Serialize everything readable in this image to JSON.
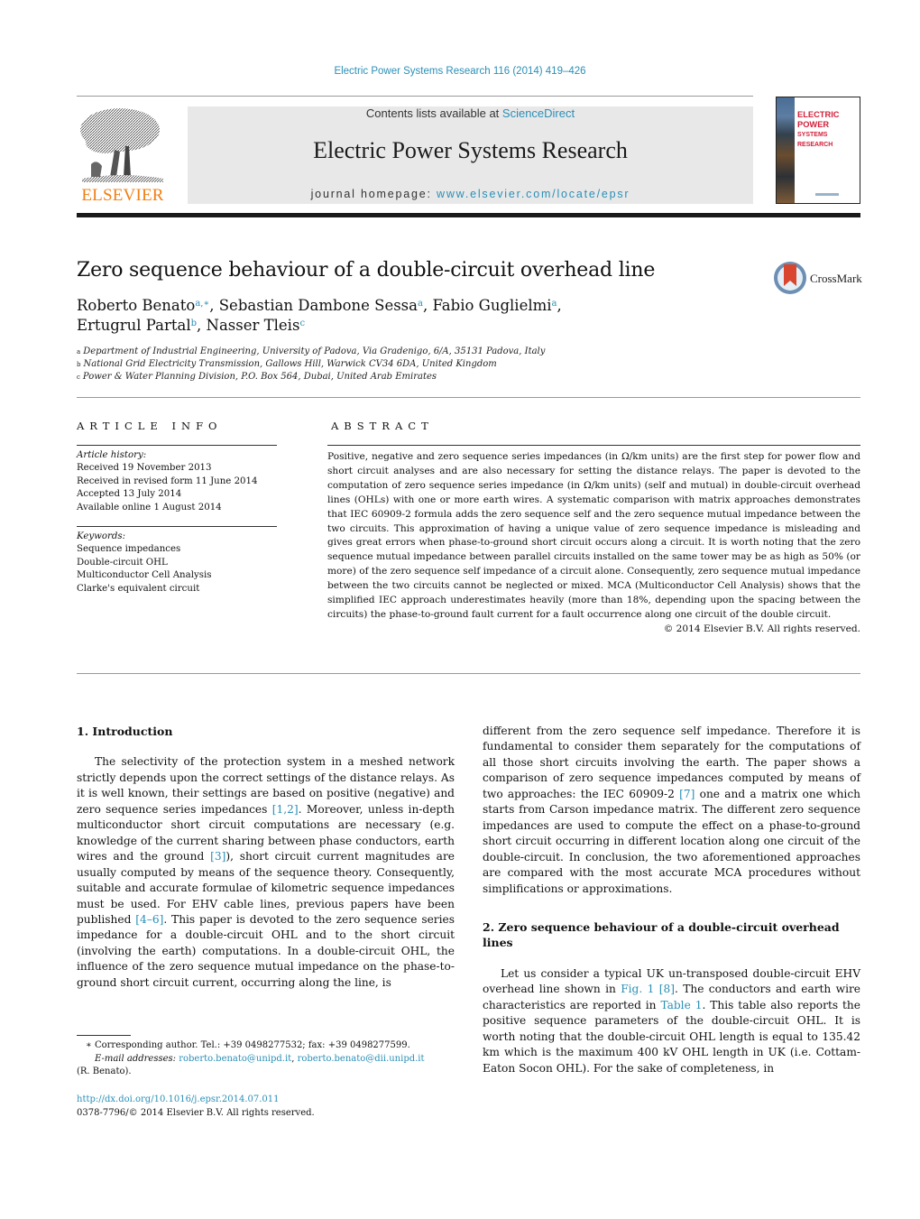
{
  "header": {
    "citation": "Electric Power Systems Research 116 (2014) 419–426",
    "publisher_logo_text": "ELSEVIER",
    "contents_prefix": "Contents lists available at ",
    "contents_link": "ScienceDirect",
    "journal_name": "Electric Power Systems Research",
    "homepage_prefix": "journal homepage: ",
    "homepage_link": "www.elsevier.com/locate/epsr",
    "cover_title_line1": "ELECTRIC POWER",
    "cover_title_line2": "SYSTEMS RESEARCH",
    "crossmark_label": "CrossMark",
    "colors": {
      "link": "#2a8fb7",
      "elsevier_orange": "#f07f13",
      "cover_red": "#d3203a",
      "banner_bg": "#e8e8e8"
    }
  },
  "article": {
    "title": "Zero sequence behaviour of a double-circuit overhead line",
    "authors": [
      {
        "name": "Roberto Benato",
        "sup": "a,∗",
        "sep": ", "
      },
      {
        "name": "Sebastian Dambone Sessa",
        "sup": "a",
        "sep": ", "
      },
      {
        "name": "Fabio Guglielmi",
        "sup": "a",
        "sep": ","
      },
      {
        "name": "Ertugrul Partal",
        "sup": "b",
        "sep": ", "
      },
      {
        "name": "Nasser Tleis",
        "sup": "c",
        "sep": ""
      }
    ],
    "affiliations": [
      {
        "key": "a",
        "text": "Department of Industrial Engineering, University of Padova, Via Gradenigo, 6/A, 35131 Padova, Italy"
      },
      {
        "key": "b",
        "text": "National Grid Electricity Transmission, Gallows Hill, Warwick CV34 6DA, United Kingdom"
      },
      {
        "key": "c",
        "text": "Power & Water Planning Division, P.O. Box 564, Dubai, United Arab Emirates"
      }
    ]
  },
  "article_info": {
    "heading": "ARTICLE INFO",
    "history_label": "Article history:",
    "history": [
      "Received 19 November 2013",
      "Received in revised form 11 June 2014",
      "Accepted 13 July 2014",
      "Available online 1 August 2014"
    ],
    "keywords_label": "Keywords:",
    "keywords": [
      "Sequence impedances",
      "Double-circuit OHL",
      "Multiconductor Cell Analysis",
      "Clarke's equivalent circuit"
    ]
  },
  "abstract": {
    "heading": "ABSTRACT",
    "text": "Positive, negative and zero sequence series impedances (in Ω/km units) are the first step for power flow and short circuit analyses and are also necessary for setting the distance relays. The paper is devoted to the computation of zero sequence series impedance (in Ω/km units) (self and mutual) in double-circuit overhead lines (OHLs) with one or more earth wires. A systematic comparison with matrix approaches demonstrates that IEC 60909-2 formula adds the zero sequence self and the zero sequence mutual impedance between the two circuits. This approximation of having a unique value of zero sequence impedance is misleading and gives great errors when phase-to-ground short circuit occurs along a circuit. It is worth noting that the zero sequence mutual impedance between parallel circuits installed on the same tower may be as high as 50% (or more) of the zero sequence self impedance of a circuit alone. Consequently, zero sequence mutual impedance between the two circuits cannot be neglected or mixed. MCA (Multiconductor Cell Analysis) shows that the simplified IEC approach underestimates heavily (more than 18%, depending upon the spacing between the circuits) the phase-to-ground fault current for a fault occurrence along one circuit of the double circuit.",
    "copyright": "© 2014 Elsevier B.V. All rights reserved."
  },
  "body": {
    "section1_heading": "1.  Introduction",
    "s1_p1_a": "The selectivity of the protection system in a meshed network strictly depends upon the correct settings of the distance relays. As it is well known, their settings are based on positive (negative) and zero sequence series impedances ",
    "s1_ref1": "[1,2]",
    "s1_p1_b": ". Moreover, unless in-depth multiconductor short circuit computations are necessary (e.g. knowledge of the current sharing between phase conductors, earth wires and the ground ",
    "s1_ref2": "[3]",
    "s1_p1_c": "), short circuit current magnitudes are usually computed by means of the sequence theory. Consequently, suitable and accurate formulae of kilometric sequence impedances must be used. For EHV cable lines, previous papers have been published ",
    "s1_ref3": "[4–6]",
    "s1_p1_d": ". This paper is devoted to the zero sequence series impedance for a double-circuit OHL and to the short circuit (involving the earth) computations. In a double-circuit OHL, the influence of the zero sequence mutual impedance on the phase-to-ground short circuit current, occurring along the line, is different from the zero sequence self impedance. Therefore it is fundamental to consider them separately for the computations of all those short circuits involving the earth. The paper shows a comparison of zero sequence impedances computed by means of two approaches: the IEC 60909-2 ",
    "s1_ref4": "[7]",
    "s1_p1_e": " one and a matrix one which starts from Carson impedance matrix. The different zero sequence impedances are used to compute the effect on a phase-to-ground short circuit occurring in different location along one circuit of the double-circuit. In conclusion, the two aforementioned approaches are compared with the most accurate MCA procedures without simplifications or approximations.",
    "section2_heading": "2.  Zero sequence behaviour of a double-circuit overhead lines",
    "s2_p1_a": "Let us consider a typical UK un-transposed double-circuit EHV overhead line shown in ",
    "s2_ref_fig": "Fig. 1",
    "s2_ref_8": "[8]",
    "s2_p1_b": ". The conductors and earth wire characteristics are reported in ",
    "s2_ref_table": "Table 1",
    "s2_p1_c": ". This table also reports the positive sequence parameters of the double-circuit OHL. It is worth noting that the double-circuit OHL length is equal to 135.42 km which is the maximum 400 kV OHL length in UK (i.e. Cottam-Eaton Socon OHL). For the sake of completeness, in"
  },
  "footnotes": {
    "corresponding_star": "∗",
    "corresponding": " Corresponding author. Tel.: +39 0498277532; fax: +39 0498277599.",
    "email_label": "E-mail addresses:",
    "email1": "roberto.benato@unipd.it",
    "email_sep": ", ",
    "email2": "roberto.benato@dii.unipd.it",
    "email_owner": "(R. Benato).",
    "doi": "http://dx.doi.org/10.1016/j.epsr.2014.07.011",
    "issn_copyright": "0378-7796/© 2014 Elsevier B.V. All rights reserved."
  }
}
